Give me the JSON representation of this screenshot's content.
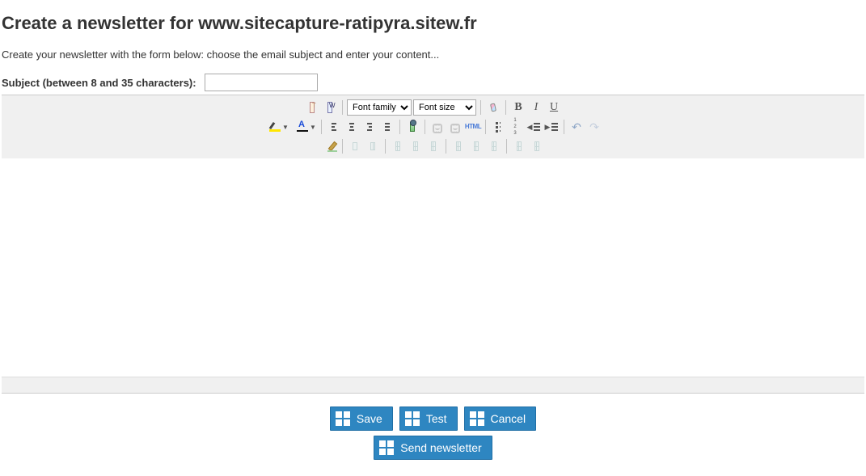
{
  "header": {
    "title": "Create a newsletter for www.sitecapture-ratipyra.sitew.fr",
    "intro": "Create your newsletter with the form below: choose the email subject and enter your content..."
  },
  "subject": {
    "label": "Subject (between 8 and 35 characters):",
    "value": ""
  },
  "toolbar": {
    "font_family_placeholder": "Font family",
    "font_size_placeholder": "Font size",
    "html_label": "HTML"
  },
  "actions": {
    "save": "Save",
    "test": "Test",
    "cancel": "Cancel",
    "send": "Send newsletter"
  }
}
